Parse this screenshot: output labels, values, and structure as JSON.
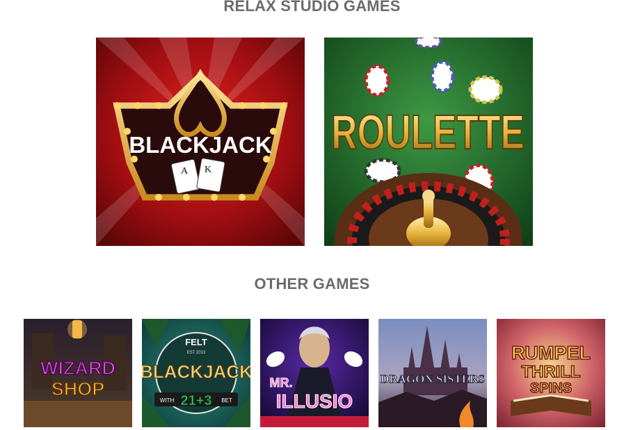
{
  "sections": {
    "relax_title": "RELAX STUDIO GAMES",
    "other_title": "OTHER GAMES"
  },
  "relax_games": [
    {
      "title": "BLACKJACK",
      "card_a": "A",
      "card_k": "K"
    },
    {
      "title": "ROULETTE"
    }
  ],
  "other_games": [
    {
      "line1": "WIZARD",
      "line2": "SHOP"
    },
    {
      "top": "FELT",
      "est": "EST 2013",
      "title": "BLACKJACK",
      "with": "WITH",
      "side": "21+3",
      "bet": "BET"
    },
    {
      "line1": "MR.",
      "line2": "ILLUSIO"
    },
    {
      "title": "DRAGON SISTERS"
    },
    {
      "line1": "RUMPEL",
      "line2": "THRILL",
      "line3": "SPINS"
    }
  ],
  "colors": {
    "heading": "#6b6b6b",
    "blackjack_bg": "#a10e12",
    "roulette_bg": "#1f6b2c",
    "gold": "#e8b43c"
  }
}
